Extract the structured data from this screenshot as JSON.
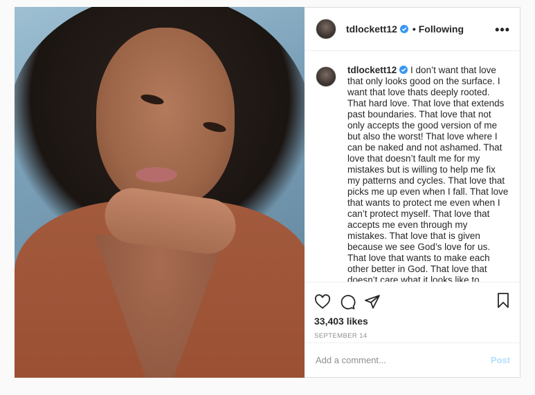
{
  "post": {
    "username": "tdlockett12",
    "follow_status": "• Following",
    "more_icon": "more-options-icon",
    "caption": {
      "username": "tdlockett12",
      "text": "I don’t want that love that only looks good on the surface. I want that love thats deeply rooted. That hard love. That love that extends past boundaries. That love that not only accepts the good version of me but also the worst! That love where I can be naked and not ashamed. That love that doesn’t fault me for my mistakes but is willing to help me fix my patterns and cycles. That love that picks me up even when I fall. That love that wants to protect me even when I can’t protect myself. That love that accepts me even through my mistakes. That love that is given because we see God’s love for us. That love that wants to make each other better in God. That love that doesn’t care what it looks like to anyone else on the outside"
    },
    "likes": "33,403 likes",
    "date": "SEPTEMBER 14",
    "comment_placeholder": "Add a comment...",
    "post_label": "Post",
    "colors": {
      "verified": "#3897f0",
      "post_button": "#b2dffc",
      "border": "#dbdbdb"
    }
  }
}
